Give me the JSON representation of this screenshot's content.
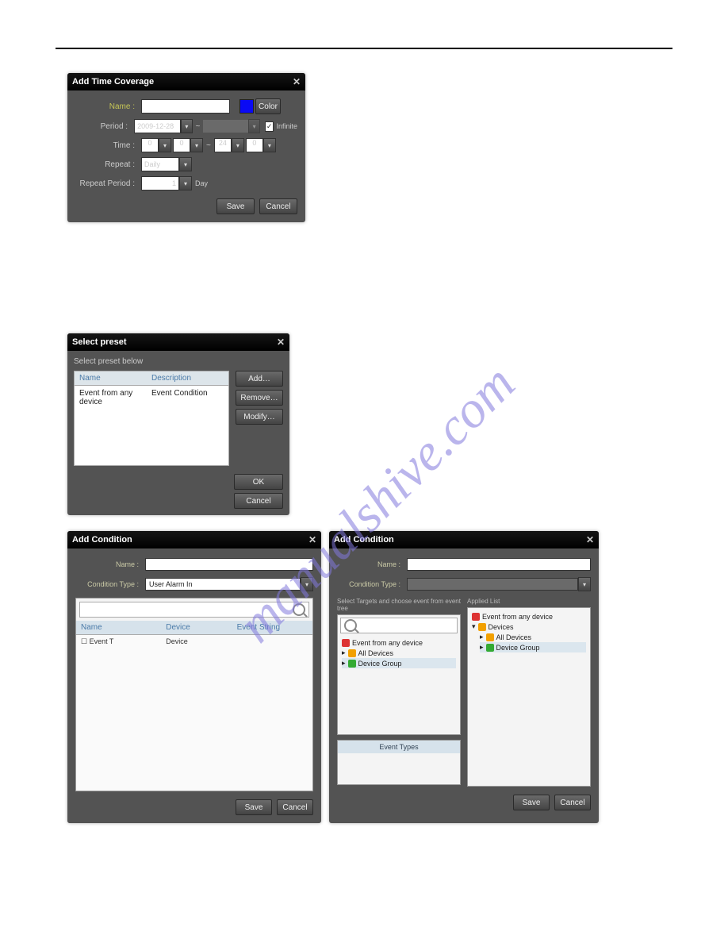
{
  "addTimeCoverage": {
    "title": "Add Time Coverage",
    "labels": {
      "name": "Name :",
      "period": "Period :",
      "time": "Time :",
      "repeat": "Repeat :",
      "repeatPeriod": "Repeat Period :"
    },
    "values": {
      "periodDate": "2009-12-28",
      "periodEnd": "",
      "timeFromH": "0",
      "timeFromM": "0",
      "timeToH": "24",
      "timeToM": "0",
      "repeat": "Daily",
      "repeatPeriodNum": "1",
      "repeatPeriodUnit": "Day"
    },
    "colorLabel": "Color",
    "infiniteLabel": "Infinite",
    "separator": "~",
    "save": "Save",
    "cancel": "Cancel"
  },
  "selectPreset": {
    "title": "Select preset",
    "instruction": "Select preset below",
    "columns": {
      "name": "Name",
      "description": "Description"
    },
    "row": {
      "name": "Event from any device",
      "description": "Event Condition"
    },
    "buttons": {
      "add": "Add…",
      "remove": "Remove…",
      "modify": "Modify…",
      "ok": "OK",
      "cancel": "Cancel"
    }
  },
  "addConditionA": {
    "title": "Add Condition",
    "labels": {
      "name": "Name :",
      "conditionType": "Condition Type :"
    },
    "values": {
      "conditionType": "User Alarm In"
    },
    "columns": {
      "name": "Name",
      "device": "Device",
      "eventString": "Event String"
    },
    "row": {
      "name": "Event T",
      "device": "Device"
    },
    "save": "Save",
    "cancel": "Cancel"
  },
  "addConditionB": {
    "title": "Add Condition",
    "labels": {
      "name": "Name :",
      "conditionType": "Condition Type :",
      "selectTargets": "Select Targets and choose event from event tree",
      "applied": "Applied List"
    },
    "leftTree": {
      "item1": "Event from any device",
      "item2": "All Devices",
      "item3": "Device Group"
    },
    "rightTree": {
      "item1": "Event from any device",
      "item2": "Devices",
      "item3": "All Devices",
      "item4": "Device Group"
    },
    "eventTypes": "Event Types",
    "save": "Save",
    "cancel": "Cancel"
  }
}
